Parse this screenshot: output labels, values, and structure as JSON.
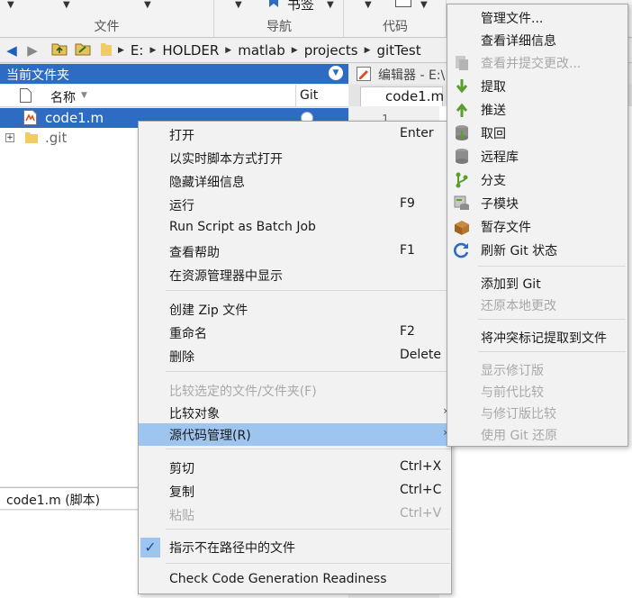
{
  "toolstrip": {
    "file_section": "文件",
    "nav_section": "导航",
    "code_section": "代码",
    "bookmark_button": "书签"
  },
  "address": {
    "crumbs": [
      "E:",
      "HOLDER",
      "matlab",
      "projects",
      "gitTest"
    ]
  },
  "current_folder": {
    "title": "当前文件夹",
    "col_name": "名称",
    "col_git": "Git",
    "files": [
      {
        "name": "code1.m"
      },
      {
        "name": ".git"
      }
    ],
    "details_label": "code1.m  (脚本)"
  },
  "editor": {
    "title": "编辑器 - E:\\",
    "tab": "code1.m",
    "line_number": "1"
  },
  "context_menu": {
    "items": [
      {
        "label": "打开",
        "shortcut": "Enter"
      },
      {
        "label": "以实时脚本方式打开",
        "shortcut": ""
      },
      {
        "label": "隐藏详细信息",
        "shortcut": ""
      },
      {
        "label": "运行",
        "shortcut": "F9"
      },
      {
        "label": "Run Script as Batch Job",
        "shortcut": ""
      },
      {
        "label": "查看帮助",
        "shortcut": "F1"
      },
      {
        "label": "在资源管理器中显示",
        "shortcut": ""
      },
      {
        "label": "创建 Zip 文件",
        "shortcut": ""
      },
      {
        "label": "重命名",
        "shortcut": "F2"
      },
      {
        "label": "删除",
        "shortcut": "Delete"
      },
      {
        "label": "比较选定的文件/文件夹(F)",
        "shortcut": ""
      },
      {
        "label": "比较对象",
        "shortcut": ""
      },
      {
        "label": "源代码管理(R)",
        "shortcut": ""
      },
      {
        "label": "剪切",
        "shortcut": "Ctrl+X"
      },
      {
        "label": "复制",
        "shortcut": "Ctrl+C"
      },
      {
        "label": "粘贴",
        "shortcut": "Ctrl+V"
      },
      {
        "label": "指示不在路径中的文件",
        "shortcut": ""
      },
      {
        "label": "Check Code Generation Readiness",
        "shortcut": ""
      }
    ]
  },
  "source_control_menu": {
    "items": [
      {
        "label": "管理文件..."
      },
      {
        "label": "查看详细信息"
      },
      {
        "label": "查看并提交更改..."
      },
      {
        "label": "提取"
      },
      {
        "label": "推送"
      },
      {
        "label": "取回"
      },
      {
        "label": "远程库"
      },
      {
        "label": "分支"
      },
      {
        "label": "子模块"
      },
      {
        "label": "暂存文件"
      },
      {
        "label": "刷新 Git 状态"
      },
      {
        "label": "添加到 Git"
      },
      {
        "label": "还原本地更改"
      },
      {
        "label": "将冲突标记提取到文件"
      },
      {
        "label": "显示修订版"
      },
      {
        "label": "与前代比较"
      },
      {
        "label": "与修订版比较"
      },
      {
        "label": "使用 Git 还原"
      }
    ]
  },
  "colors": {
    "selection_blue": "#2e6cc3",
    "menu_highlight": "#9ec5f0",
    "menu_bg": "#f2f2f2",
    "disabled_text": "#a8a8a8"
  }
}
